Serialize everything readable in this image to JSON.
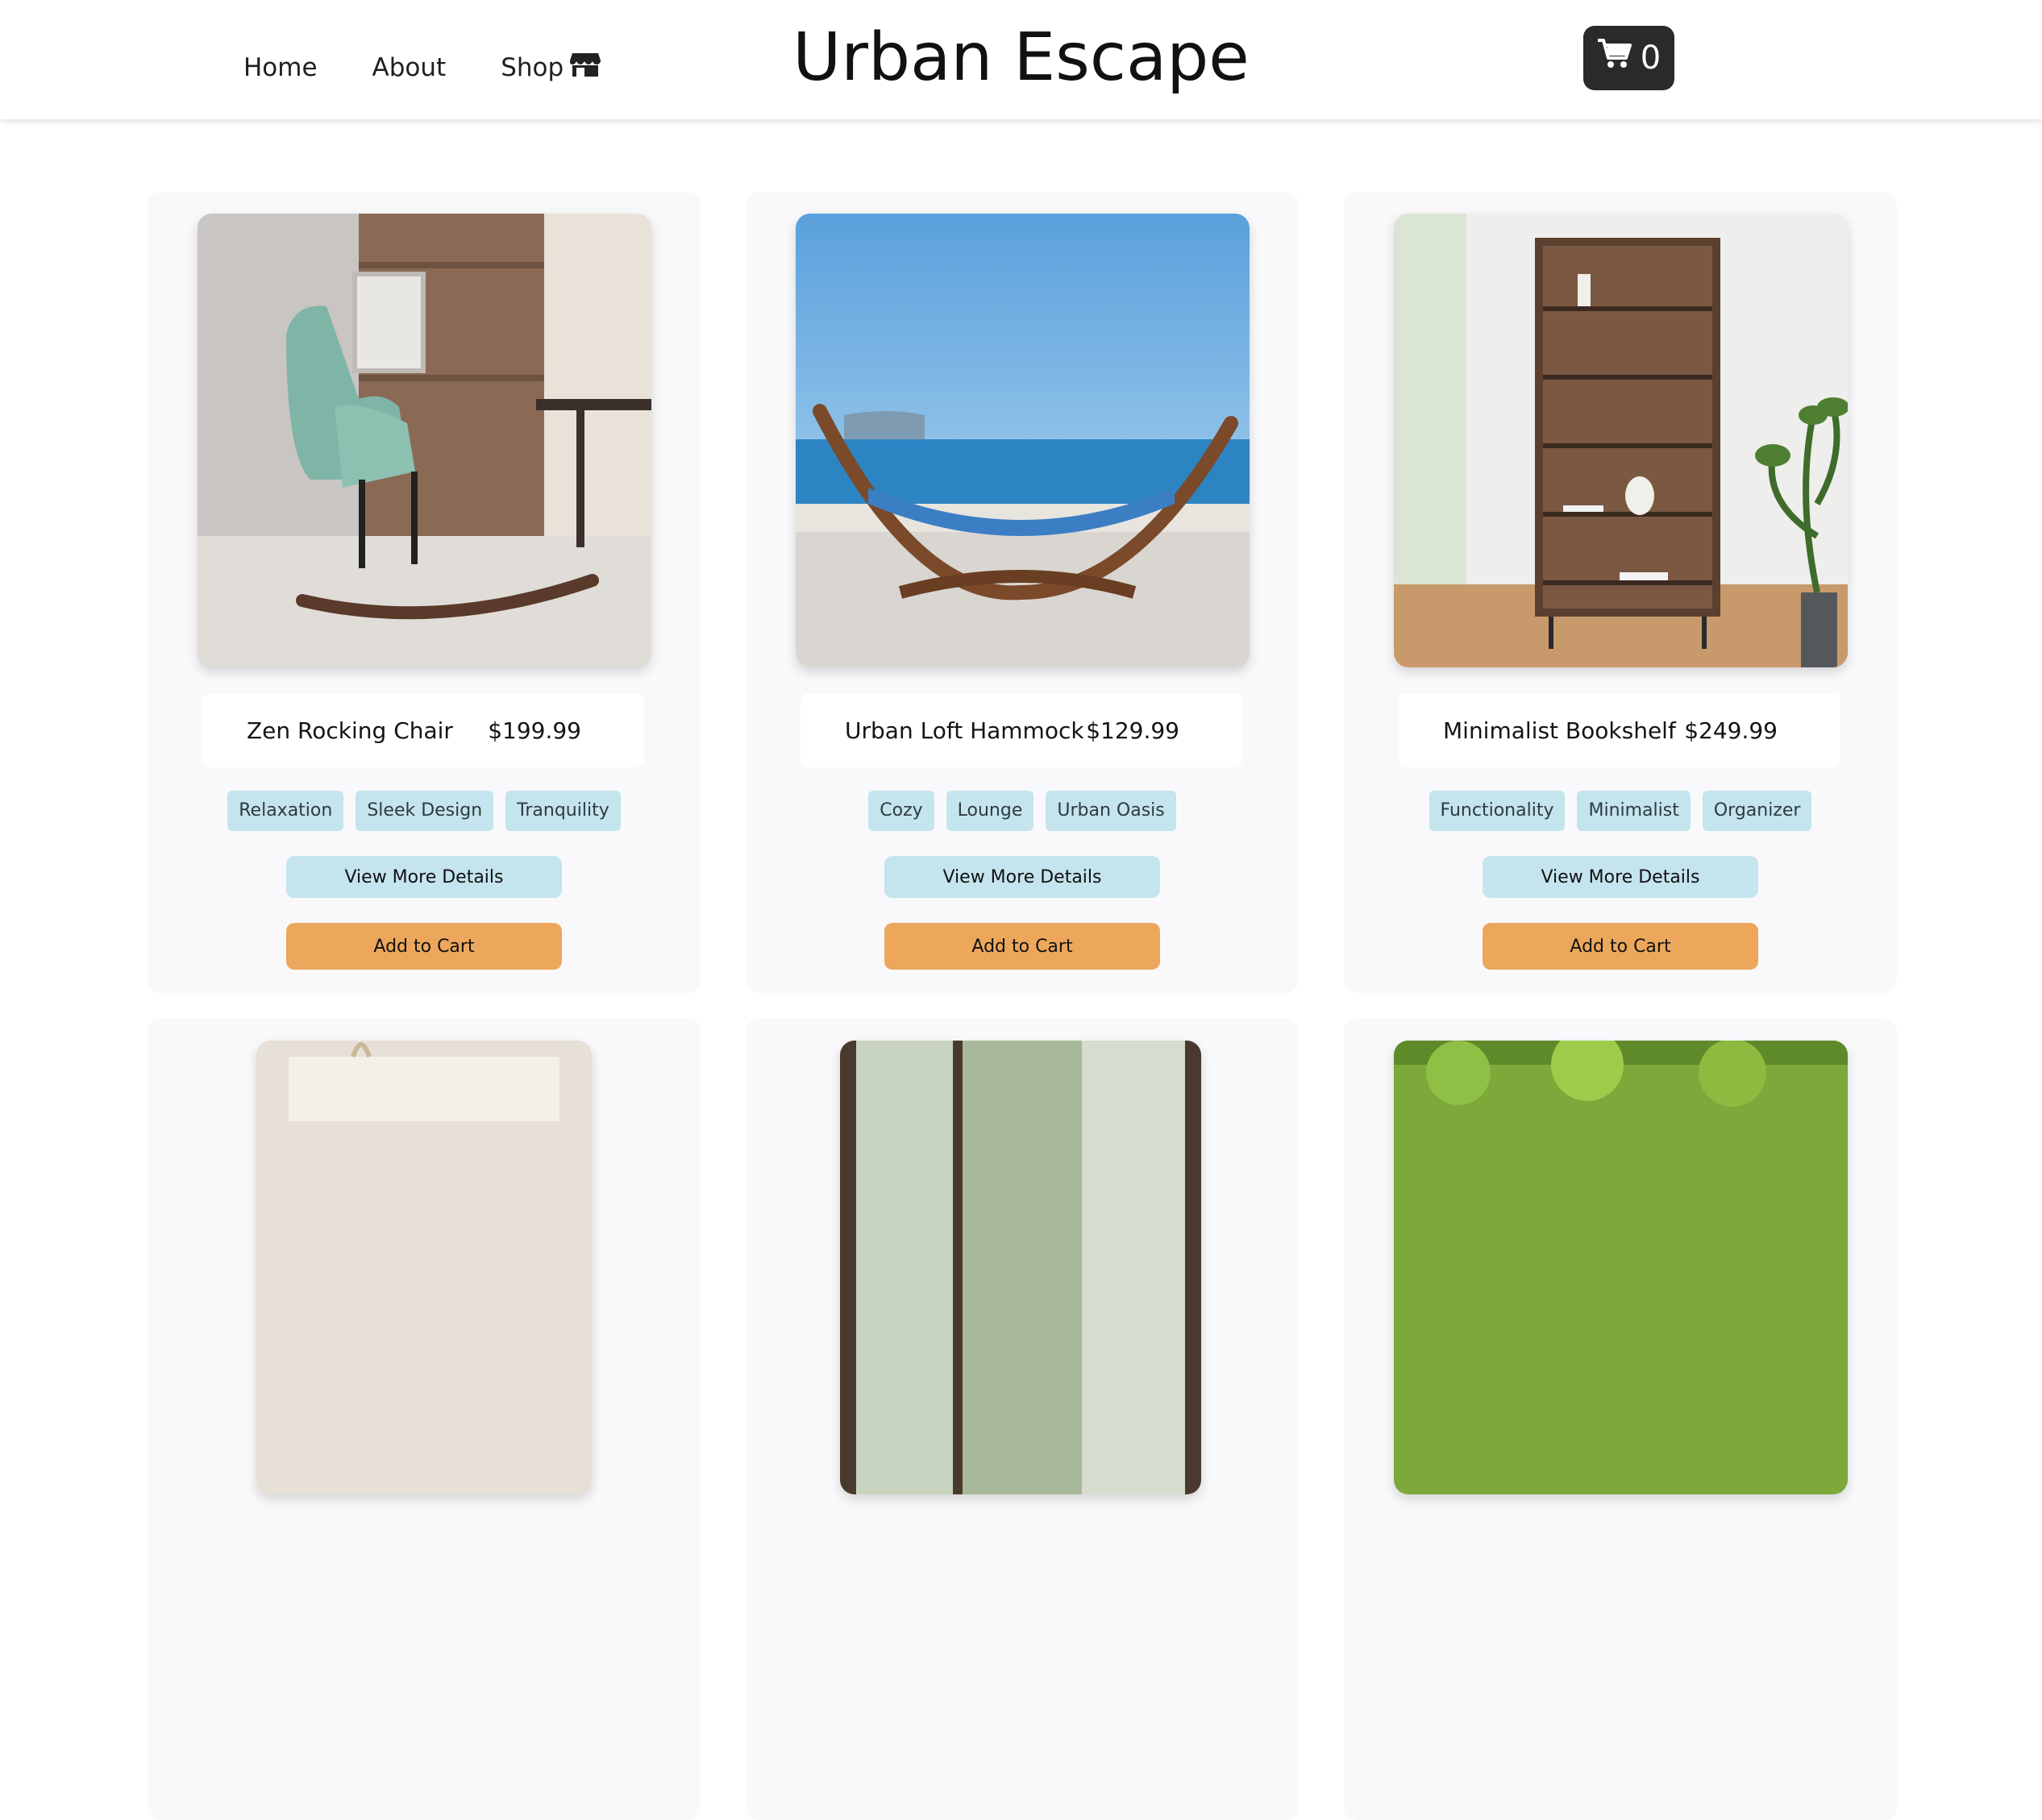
{
  "header": {
    "nav": [
      {
        "label": "Home"
      },
      {
        "label": "About"
      },
      {
        "label": "Shop",
        "icon": "store-icon"
      }
    ],
    "brand": "Urban Escape",
    "cart": {
      "icon": "shopping-cart-icon",
      "count": "0"
    }
  },
  "products": [
    {
      "name": "Zen Rocking Chair",
      "price": "$199.99",
      "tags": [
        "Relaxation",
        "Sleek Design",
        "Tranquility"
      ],
      "details_label": "View More Details",
      "cart_label": "Add to Cart"
    },
    {
      "name": "Urban Loft Hammock",
      "price": "$129.99",
      "tags": [
        "Cozy",
        "Lounge",
        "Urban Oasis"
      ],
      "details_label": "View More Details",
      "cart_label": "Add to Cart"
    },
    {
      "name": "Minimalist Bookshelf",
      "price": "$249.99",
      "tags": [
        "Functionality",
        "Minimalist",
        "Organizer"
      ],
      "details_label": "View More Details",
      "cart_label": "Add to Cart"
    }
  ],
  "colors": {
    "accent_orange": "#eca75c",
    "tag_blue": "#c4e4ee",
    "cart_dark": "#2a2a2a"
  }
}
